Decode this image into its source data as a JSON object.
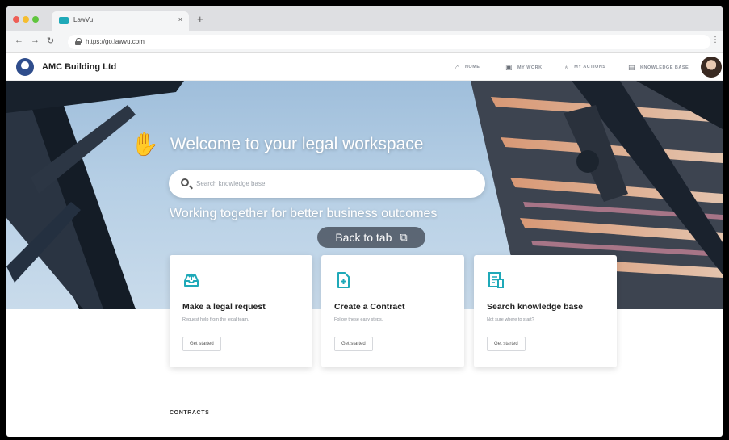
{
  "browser": {
    "tab_title": "LawVu",
    "url": "https://go.lawvu.com",
    "new_tab_symbol": "+",
    "close_symbol": "×"
  },
  "header": {
    "company_name": "AMC Building Ltd",
    "nav": [
      {
        "label": "HOME",
        "icon": "home-icon"
      },
      {
        "label": "MY WORK",
        "icon": "briefcase-icon"
      },
      {
        "label": "MY ACTIONS",
        "icon": "lightbulb-icon"
      },
      {
        "label": "KNOWLEDGE BASE",
        "icon": "book-icon"
      }
    ]
  },
  "hero": {
    "title": "Welcome to your legal workspace",
    "search_placeholder": "Search knowledge base",
    "tagline": "Working together for better business outcomes",
    "back_to_tab": "Back to tab"
  },
  "cards": [
    {
      "title": "Make a legal request",
      "desc": "Request help from the legal team.",
      "button": "Get started",
      "icon": "inbox-upload-icon"
    },
    {
      "title": "Create a Contract",
      "desc": "Follow these easy steps.",
      "button": "Get started",
      "icon": "document-add-icon"
    },
    {
      "title": "Search knowledge base",
      "desc": "Not sure where to start?",
      "button": "Get started",
      "icon": "knowledge-doc-icon"
    }
  ],
  "sections": {
    "contracts_label": "CONTRACTS"
  },
  "colors": {
    "accent": "#1fa9b8",
    "brand": "#2f4d8c"
  }
}
